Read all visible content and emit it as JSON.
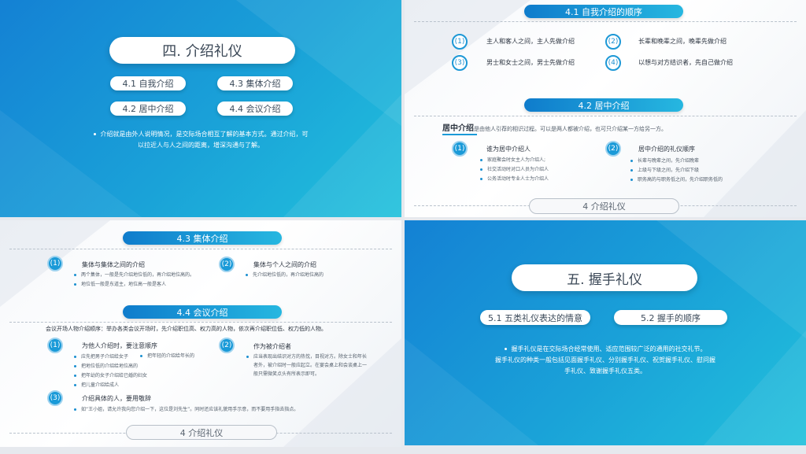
{
  "slide1": {
    "title": "四. 介绍礼仪",
    "items": [
      "4.1 自我介绍",
      "4.3 集体介绍",
      "4.2 居中介绍",
      "4.4 会议介绍"
    ],
    "para_line1": "介绍就是由外人说明情况，是交际场合相互了解的基本方式。通过介绍，可",
    "para_line2": "以拉近人与人之间的距离，增深沟通与了解。"
  },
  "slide2": {
    "header1": "4.1 自我介绍的顺序",
    "points": [
      {
        "num": "(1)",
        "text": "主人和客人之间，主人先做介绍"
      },
      {
        "num": "(2)",
        "text": "长辈和晚辈之间，晚辈先做介绍"
      },
      {
        "num": "(3)",
        "text": "男士和女士之间，男士先做介绍"
      },
      {
        "num": "(4)",
        "text": "以想与对方结识者，先自己做介绍"
      }
    ],
    "header2": "4.2 居中介绍",
    "intro_bold": "居中介绍",
    "intro_rest": "是由他人引荐的相识过程。可以是两人都被介绍，也可只介绍某一方给另一方。",
    "left": {
      "num": "(1)",
      "title": "谁为居中介绍人",
      "bullets": [
        "家庭聚会时女主人为介绍人;",
        "社交活动时对口人员为介绍人",
        "公务活动时专业人士为介绍人"
      ]
    },
    "right": {
      "num": "(2)",
      "title": "居中介绍的礼仪顺序",
      "bullets": [
        "长辈与晚辈之间，先介绍晚辈",
        "上级与下级之间，先介绍下级",
        "职务高的与职务低之间，先介绍职务低的"
      ]
    },
    "footer": "4 介绍礼仪"
  },
  "slide3": {
    "header1": "4.3 集体介绍",
    "left": {
      "num": "(1)",
      "title": "集体与集体之间的介绍",
      "bullets": [
        "两个集体，一般是先介绍地位低的，再介绍地位高的。",
        "地位低一般是东道主，地位高一般是客人"
      ]
    },
    "right": {
      "num": "(2)",
      "title": "集体与个人之间的介绍",
      "bullets": [
        "先介绍地位低的，再介绍地位高的"
      ]
    },
    "header2": "4.4 会议介绍",
    "intro": "会议开场人物介绍顺序：举办各类会议开场时，先介绍职位高、权力高的人物，依次再介绍职位低、权力低的人物。",
    "b1": {
      "num": "(1)",
      "title": "为他人介绍时，要注意顺序",
      "bullets": [
        "应先把男子介绍给女子",
        "把地位低的介绍给地位高的",
        "把年幼的女子介绍给已婚的妇女",
        "把儿童介绍给成人"
      ],
      "side": "把年轻的介绍给年长的"
    },
    "b2": {
      "num": "(2)",
      "title": "作为被介绍者",
      "lines": [
        "应当表现出结识对方的热忱，目视对方。除女士和年长",
        "者外，被介绍时一般应起立。在宴会桌上和会谈桌上一",
        "般只需微笑点头有所表示即可。"
      ]
    },
    "b3": {
      "num": "(3)",
      "title": "介绍具体的人，要用敬辞",
      "text": "如“王小姐，请允许我向您介绍一下，这位是刘先生”。同时还应该礼貌用手示意，而不要用手指去指点。"
    },
    "footer": "4 介绍礼仪"
  },
  "slide4": {
    "title": "五. 握手礼仪",
    "items": [
      "5.1 五类礼仪表达的情意",
      "5.2 握手的顺序"
    ],
    "para_line1": "握手礼仪是在交际场合经常使用、适应范围较广泛的通用的社交礼节。",
    "para_line2": "握手礼仪的种类一般包括见面握手礼仪、分别握手礼仪、祝贺握手礼仪、慰问握",
    "para_line3": "手礼仪、致谢握手礼仪五类。"
  }
}
